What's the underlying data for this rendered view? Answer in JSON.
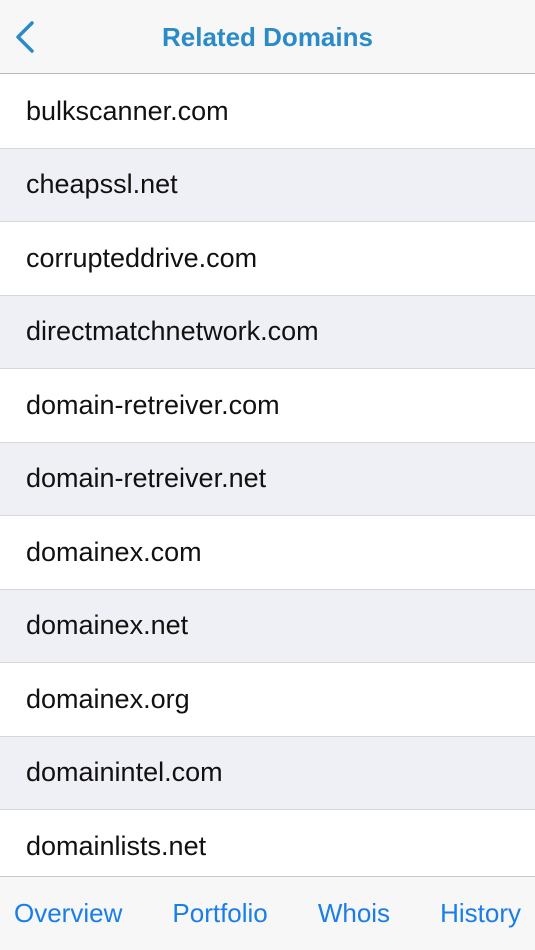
{
  "navbar": {
    "title": "Related Domains",
    "back_icon": "chevron-left-icon",
    "accent_color": "#2a8bc7"
  },
  "domains": [
    "bulkscanner.com",
    "cheapssl.net",
    "corrupteddrive.com",
    "directmatchnetwork.com",
    "domain-retreiver.com",
    "domain-retreiver.net",
    "domainex.com",
    "domainex.net",
    "domainex.org",
    "domainintel.com",
    "domainlists.net"
  ],
  "tabbar": {
    "tabs": [
      "Overview",
      "Portfolio",
      "Whois",
      "History"
    ],
    "tab_color": "#1a7ee6"
  }
}
